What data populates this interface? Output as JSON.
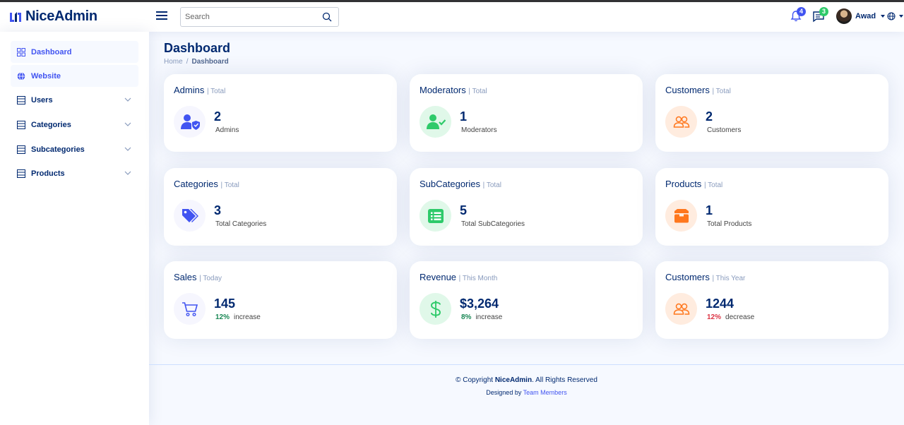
{
  "header": {
    "logo_text": "NiceAdmin",
    "search_placeholder": "Search",
    "notifications_count": "4",
    "messages_count": "3",
    "user_name": "Awad"
  },
  "sidebar": {
    "items": [
      {
        "label": "Dashboard",
        "icon": "grid-icon"
      },
      {
        "label": "Website",
        "icon": "globe-icon"
      },
      {
        "label": "Users",
        "icon": "list-icon"
      },
      {
        "label": "Categories",
        "icon": "list-icon"
      },
      {
        "label": "Subcategories",
        "icon": "list-icon"
      },
      {
        "label": "Products",
        "icon": "list-icon"
      }
    ]
  },
  "page": {
    "title": "Dashboard",
    "breadcrumb": [
      "Home",
      "/",
      "Dashboard"
    ]
  },
  "cards": [
    {
      "title": "Admins",
      "sub": "| Total",
      "value": "2",
      "label": "Admins",
      "icon": "user-shield-icon"
    },
    {
      "title": "Moderators",
      "sub": "| Total",
      "value": "1",
      "label": "Moderators",
      "icon": "user-check-icon"
    },
    {
      "title": "Customers",
      "sub": "| Total",
      "value": "2",
      "label": "Customers",
      "icon": "people-icon"
    },
    {
      "title": "Categories",
      "sub": "| Total",
      "value": "3",
      "label": "Total Categories",
      "icon": "tags-icon"
    },
    {
      "title": "SubCategories",
      "sub": "| Total",
      "value": "5",
      "label": "Total SubCategories",
      "icon": "list-box-icon"
    },
    {
      "title": "Products",
      "sub": "| Total",
      "value": "1",
      "label": "Total Products",
      "icon": "box-icon"
    },
    {
      "title": "Sales",
      "sub": "| Today",
      "value": "145",
      "pct": "12%",
      "label": "increase",
      "icon": "cart-icon"
    },
    {
      "title": "Revenue",
      "sub": "| This Month",
      "value": "$3,264",
      "pct": "8%",
      "label": "increase",
      "icon": "dollar-icon"
    },
    {
      "title": "Customers",
      "sub": "| This Year",
      "value": "1244",
      "pct": "12%",
      "label": "decrease",
      "icon": "people-icon"
    }
  ],
  "footer": {
    "copy_prefix": "© Copyright ",
    "brand": "NiceAdmin",
    "copy_suffix": ". All Rights Reserved",
    "designed_by": "Designed by ",
    "team": "Team Members"
  },
  "colors": {
    "primary": "#4154f1",
    "navy": "#012970",
    "green": "#2eca6a",
    "orange": "#ff771d",
    "danger": "#dc3545",
    "success": "#198754"
  }
}
